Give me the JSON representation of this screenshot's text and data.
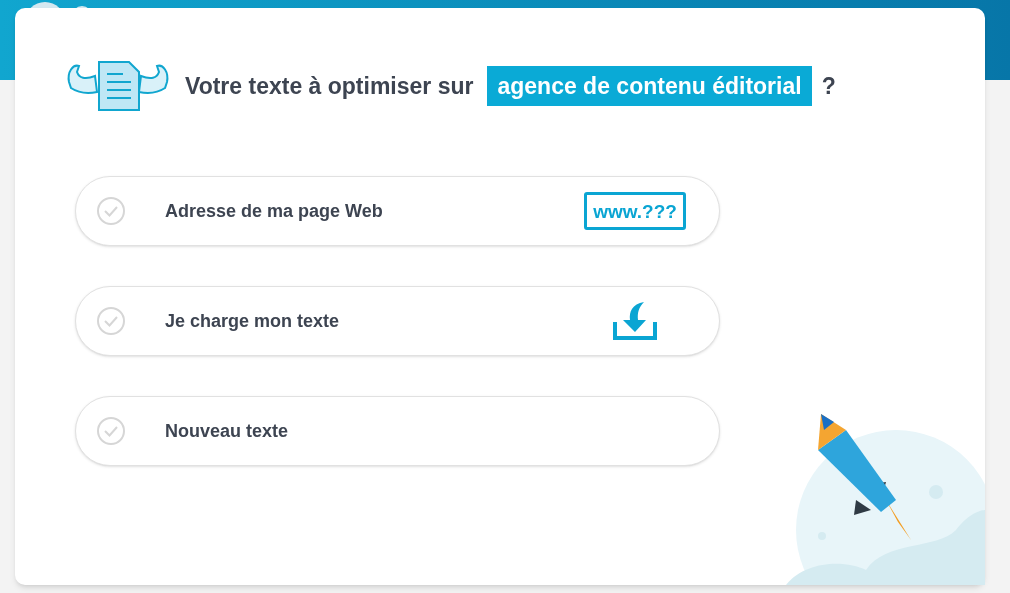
{
  "heading": {
    "text": "Votre texte à optimiser sur",
    "highlight": "agence de contenu éditorial",
    "suffix": "?"
  },
  "options": [
    {
      "label": "Adresse de ma page Web",
      "kind": "url",
      "badge": "www.???",
      "selected": false
    },
    {
      "label": "Je charge mon texte",
      "kind": "upload",
      "selected": false
    },
    {
      "label": "Nouveau texte",
      "kind": "blank",
      "selected": false
    }
  ]
}
